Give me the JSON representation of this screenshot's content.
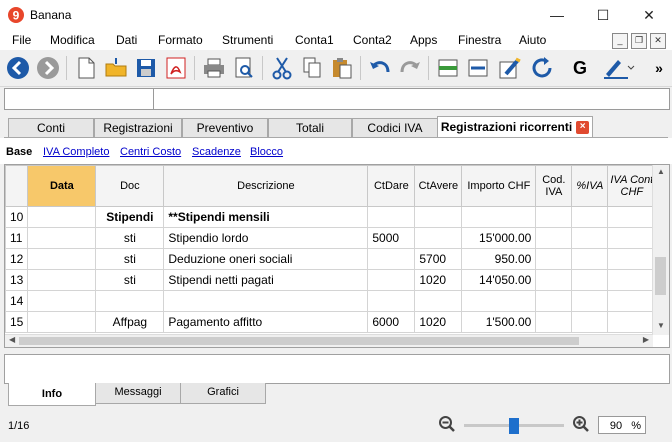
{
  "window": {
    "title": "Banana"
  },
  "menu": [
    "File",
    "Modifica",
    "Dati",
    "Formato",
    "Strumenti",
    "Conta1",
    "Conta2",
    "Apps",
    "Finestra",
    "Aiuto"
  ],
  "tabs": [
    "Conti",
    "Registrazioni",
    "Preventivo",
    "Totali",
    "Codici IVA",
    "Registrazioni ricorrenti"
  ],
  "views": [
    "Base",
    "IVA Completo",
    "Centri Costo",
    "Scadenze",
    "Blocco"
  ],
  "table": {
    "headers": [
      "",
      "Data",
      "Doc",
      "Descrizione",
      "CtDare",
      "CtAvere",
      "Importo CHF",
      "Cod. IVA",
      "%IVA",
      "IVA Cont CHF"
    ],
    "rows": [
      [
        "10",
        "",
        "Stipendi",
        "**Stipendi mensili",
        "",
        "",
        "",
        "",
        "",
        ""
      ],
      [
        "11",
        "",
        "sti",
        "Stipendio lordo",
        "5000",
        "",
        "15'000.00",
        "",
        "",
        ""
      ],
      [
        "12",
        "",
        "sti",
        "Deduzione oneri sociali",
        "",
        "5700",
        "950.00",
        "",
        "",
        ""
      ],
      [
        "13",
        "",
        "sti",
        "Stipendi netti pagati",
        "",
        "1020",
        "14'050.00",
        "",
        "",
        ""
      ],
      [
        "14",
        "",
        "",
        "",
        "",
        "",
        "",
        "",
        "",
        ""
      ],
      [
        "15",
        "",
        "Affpag",
        "Pagamento affitto",
        "6000",
        "1020",
        "1'500.00",
        "",
        "",
        ""
      ]
    ]
  },
  "bottom_tabs": [
    "Info",
    "Messaggi",
    "Grafici"
  ],
  "status": {
    "page": "1/16",
    "zoom": "90",
    "zoom_unit": "%"
  },
  "slider": {
    "value_fraction": 0.5
  },
  "colors": {
    "accent": "#1e5aa8",
    "data_header": "#f7c86a",
    "tab_close": "#e04a30"
  },
  "toolbar_icons": [
    "back-icon",
    "forward-icon",
    "new-file-icon",
    "open-folder-icon",
    "save-icon",
    "pdf-icon",
    "print-icon",
    "print-preview-icon",
    "cut-icon",
    "copy-icon",
    "paste-icon",
    "undo-icon",
    "redo-icon",
    "insert-rows-icon",
    "delete-rows-icon",
    "edit-icon",
    "refresh-icon",
    "g-icon",
    "pen-icon",
    "more-icon"
  ]
}
